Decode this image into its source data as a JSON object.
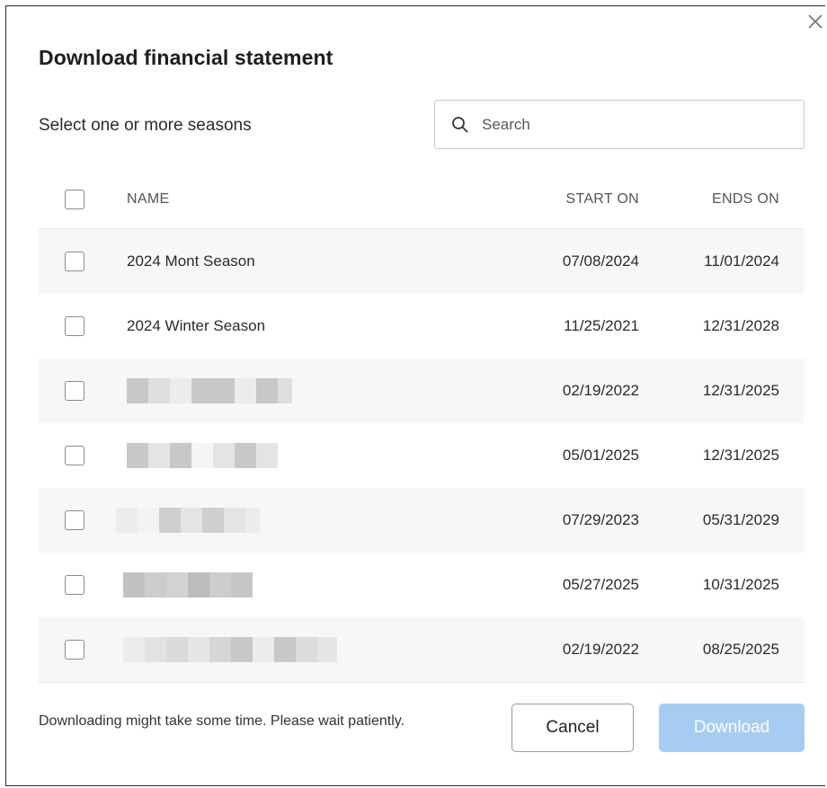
{
  "dialog": {
    "title": "Download financial statement",
    "close_icon": "close-icon"
  },
  "selection": {
    "label": "Select one or more seasons"
  },
  "search": {
    "placeholder": "Search",
    "value": "",
    "icon": "search-icon"
  },
  "table": {
    "columns": {
      "name": "NAME",
      "start": "START ON",
      "end": "ENDS ON"
    },
    "rows": [
      {
        "name": "2024 Mont Season",
        "start": "07/08/2024",
        "end": "11/01/2024",
        "checked": false
      },
      {
        "name": "2024 Winter Season",
        "start": "11/25/2021",
        "end": "12/31/2028",
        "checked": false
      },
      {
        "name": "",
        "start": "02/19/2022",
        "end": "12/31/2025",
        "checked": false
      },
      {
        "name": "",
        "start": "05/01/2025",
        "end": "12/31/2025",
        "checked": false
      },
      {
        "name": "",
        "start": "07/29/2023",
        "end": "05/31/2029",
        "checked": false
      },
      {
        "name": "",
        "start": "05/27/2025",
        "end": "10/31/2025",
        "checked": false
      },
      {
        "name": "",
        "start": "02/19/2022",
        "end": "08/25/2025",
        "checked": false
      }
    ]
  },
  "footer": {
    "note": "Downloading might take some time. Please wait patiently.",
    "cancel_label": "Cancel",
    "download_label": "Download"
  },
  "colors": {
    "download_disabled_bg": "#a7ccf2",
    "row_shade": "#f7f7f7",
    "redaction_dark": "#c8c8c8",
    "redaction_light": "#e4e4e4"
  }
}
